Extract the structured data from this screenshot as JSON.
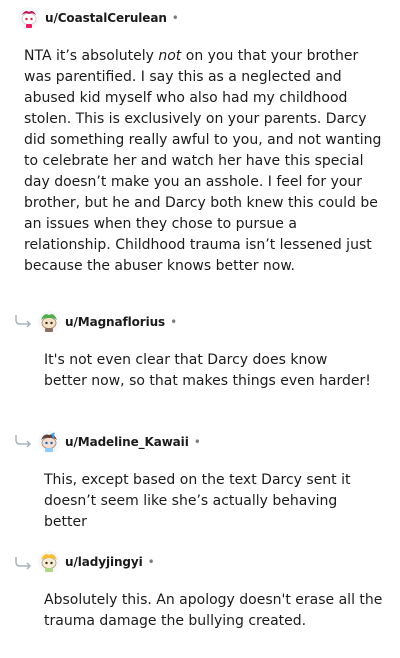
{
  "comments": [
    {
      "username": "u/CoastalCerulean",
      "separator": "•",
      "avatar": "snoo-avatar-red-hair",
      "body": {
        "before_em": "NTA it’s absolutely ",
        "em": "not",
        "after_em": " on you that your brother was parentified. I say this as a neglected and abused kid myself who also had my childhood stolen. This is exclusively on your parents. Darcy did something really awful to you, and not wanting to celebrate her and watch her have this special day doesn’t make you an asshole. I feel for your brother, but he and Darcy both knew this could be an issues when they chose to pursue a relationship. Childhood trauma isn’t lessened just because the abuser knows better now."
      }
    },
    {
      "username": "u/Magnaflorius",
      "separator": "•",
      "avatar": "snoo-avatar-green",
      "reply_icon": "reply-arrow-icon",
      "body": "It's not even clear that Darcy does know better now, so that makes things even harder!"
    },
    {
      "username": "u/Madeline_Kawaii",
      "separator": "•",
      "avatar": "snoo-avatar-blue-bow",
      "reply_icon": "reply-arrow-icon",
      "body": "This, except based on the text Darcy sent it doesn’t seem like she’s actually behaving better"
    },
    {
      "username": "u/ladyjingyi",
      "separator": "•",
      "avatar": "snoo-avatar-yellow",
      "reply_icon": "reply-arrow-icon",
      "body": "Absolutely this. An apology doesn't erase all the trauma damage the bullying created."
    }
  ]
}
